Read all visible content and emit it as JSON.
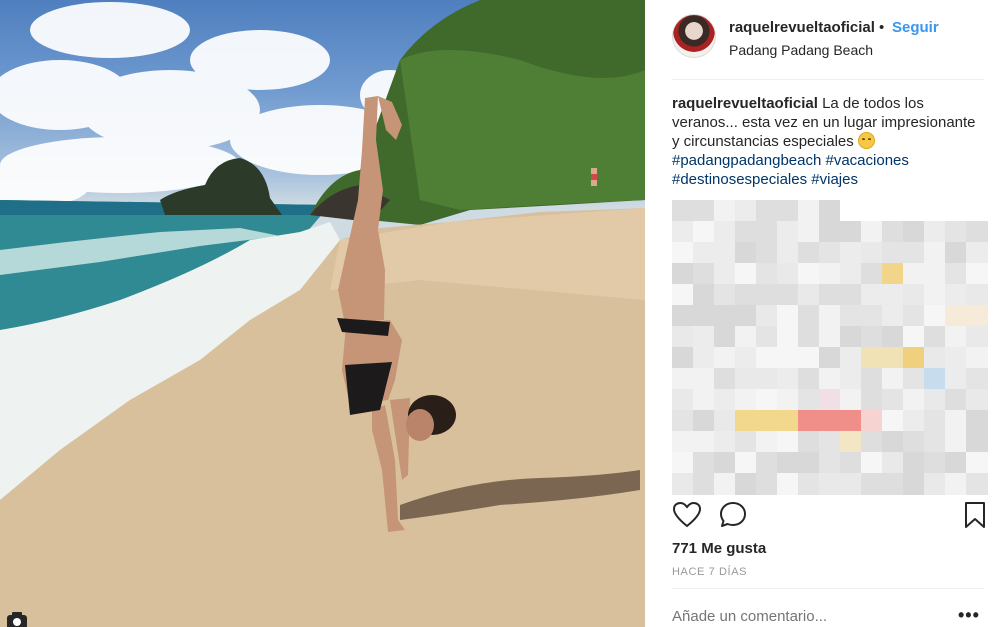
{
  "post": {
    "username": "raquelrevueltaoficial",
    "separator": "•",
    "follow_label": "Seguir",
    "location": "Padang Padang Beach"
  },
  "caption": {
    "username": "raquelrevueltaoficial",
    "text": "La de todos los veranos... esta vez en un lugar impresionante y circunstancias especiales",
    "emoji": "smiling-face-emoji",
    "hashtags": [
      "#padangpadangbeach",
      "#vacaciones",
      "#destinosespeciales",
      "#viajes"
    ]
  },
  "engagement": {
    "likes_label": "771 Me gusta",
    "time_label": "HACE 7 DÍAS"
  },
  "comment_box": {
    "placeholder": "Añade un comentario...",
    "more_label": "•••"
  },
  "icons": {
    "like": "heart-icon",
    "comment": "comment-bubble-icon",
    "save": "bookmark-icon",
    "camera": "camera-icon"
  },
  "colors": {
    "link_blue": "#3897f0",
    "hashtag": "#003569",
    "muted": "#999999"
  }
}
